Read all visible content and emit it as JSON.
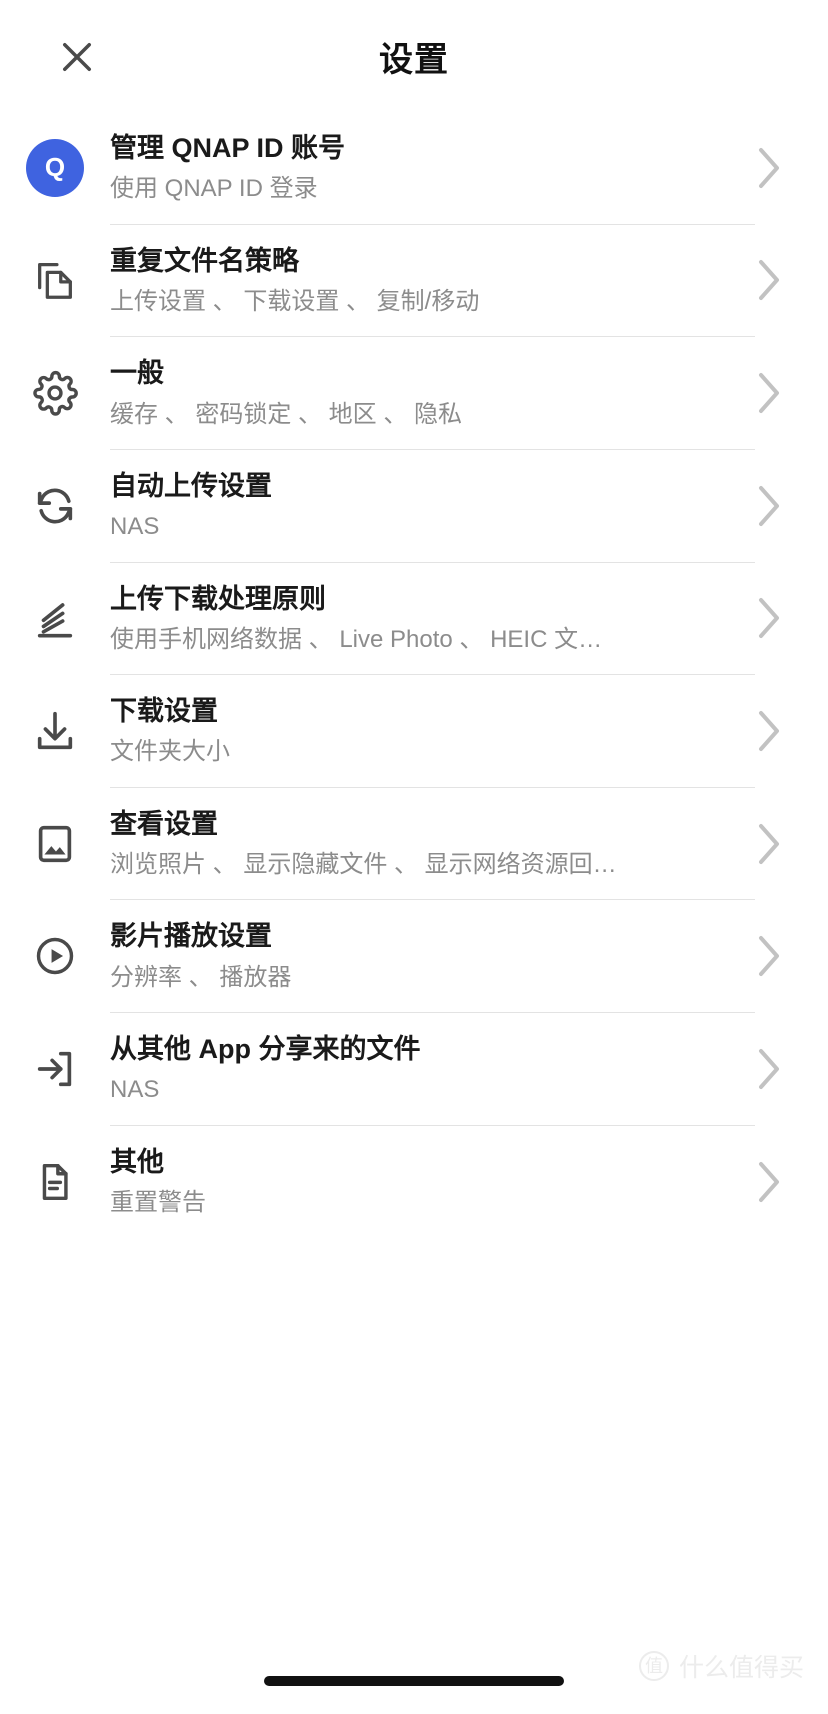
{
  "header": {
    "close_icon": "close-icon",
    "title": "设置"
  },
  "list": [
    {
      "icon": "qnap-account-avatar",
      "avatar_letter": "Q",
      "title": "管理 QNAP ID 账号",
      "subtitle": "使用 QNAP ID 登录",
      "chevron": "chevron-right-icon"
    },
    {
      "icon": "copy-files-icon",
      "title": "重复文件名策略",
      "subtitle": "上传设置 、 下载设置 、 复制/移动",
      "chevron": "chevron-right-icon"
    },
    {
      "icon": "gear-icon",
      "title": "一般",
      "subtitle": "缓存 、 密码锁定 、 地区 、 隐私",
      "chevron": "chevron-right-icon"
    },
    {
      "icon": "sync-icon",
      "title": "自动上传设置",
      "subtitle": "NAS",
      "chevron": "chevron-right-icon"
    },
    {
      "icon": "transfer-rules-icon",
      "title": "上传下载处理原则",
      "subtitle": "使用手机网络数据 、 Live Photo 、 HEIC 文…",
      "chevron": "chevron-right-icon"
    },
    {
      "icon": "download-icon",
      "title": "下载设置",
      "subtitle": "文件夹大小",
      "chevron": "chevron-right-icon"
    },
    {
      "icon": "image-icon",
      "title": "查看设置",
      "subtitle": "浏览照片 、 显示隐藏文件 、 显示网络资源回…",
      "chevron": "chevron-right-icon"
    },
    {
      "icon": "play-circle-icon",
      "title": "影片播放设置",
      "subtitle": "分辨率 、 播放器",
      "chevron": "chevron-right-icon"
    },
    {
      "icon": "import-arrow-icon",
      "title": "从其他 App 分享来的文件",
      "subtitle": "NAS",
      "chevron": "chevron-right-icon"
    },
    {
      "icon": "document-icon",
      "title": "其他",
      "subtitle": "重置警告",
      "chevron": "chevron-right-icon"
    }
  ],
  "watermark": {
    "badge": "值",
    "text": "什么值得买"
  },
  "colors": {
    "accent": "#3f63e0",
    "title": "#1a1a1a",
    "subtitle": "#8c8c8c",
    "divider": "#e3e3e3",
    "chevron": "#c2c2c2"
  }
}
